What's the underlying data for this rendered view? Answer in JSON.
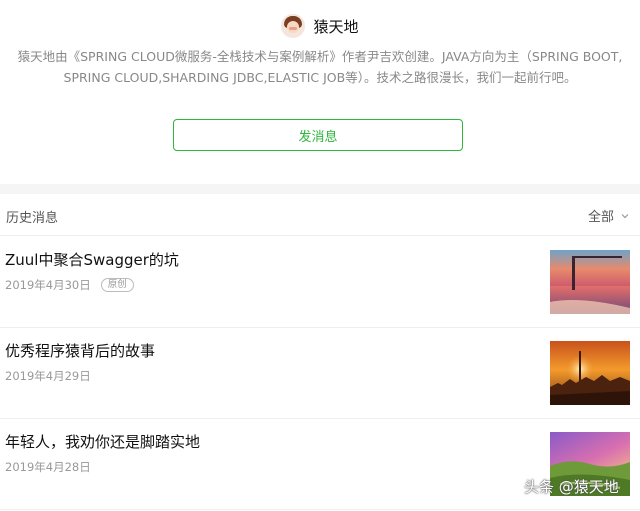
{
  "profile": {
    "name": "猿天地",
    "avatar_icon": "cartoon-avatar-icon",
    "bio": "猿天地由《SPRING CLOUD微服务-全栈技术与案例解析》作者尹吉欢创建。JAVA方向为主（SPRING BOOT, SPRING CLOUD,SHARDING JDBC,ELASTIC JOB等）。技术之路很漫长，我们一起前行吧。",
    "send_button": "发消息"
  },
  "history": {
    "title": "历史消息",
    "filter": "全部",
    "filter_icon": "chevron-down-icon"
  },
  "articles": [
    {
      "title": "Zuul中聚合Swagger的坑",
      "date": "2019年4月30日",
      "badge": "原创"
    },
    {
      "title": "优秀程序猿背后的故事",
      "date": "2019年4月29日"
    },
    {
      "title": "年轻人，我劝你还是脚踏实地",
      "date": "2019年4月28日"
    }
  ],
  "watermark": "头条 @猿天地",
  "colors": {
    "accent_green": "#2fb63c",
    "muted_text": "#888888"
  }
}
